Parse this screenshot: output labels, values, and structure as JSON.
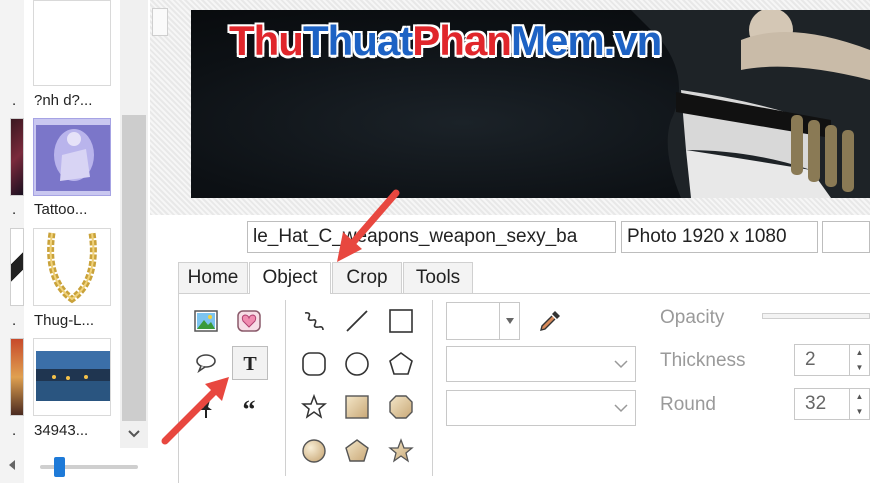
{
  "left_strip": {
    "labels": [
      ".",
      ".",
      ".",
      "."
    ]
  },
  "thumbnails": [
    {
      "label": "?nh d?..."
    },
    {
      "label": "Tattoo..."
    },
    {
      "label": "Thug-L..."
    },
    {
      "label": "34943..."
    }
  ],
  "photo": {
    "watermark": {
      "part1": "Thu",
      "part2": "Thuat",
      "part3": "Phan",
      "part4": "Mem.vn"
    }
  },
  "status_bar": {
    "filename": "le_Hat_C_weapons_weapon_sexy_ba",
    "info": "Photo 1920 x 1080"
  },
  "tabs": [
    {
      "label": "Home"
    },
    {
      "label": "Object",
      "active": true
    },
    {
      "label": "Crop"
    },
    {
      "label": "Tools"
    }
  ],
  "object_tools": {
    "left_icons": [
      "image-icon",
      "sticker-icon",
      "speech-bubble-icon",
      "text-icon",
      "pin-icon",
      "quote-icon"
    ],
    "shape_icons": [
      "freehand-icon",
      "line-icon",
      "rectangle-icon",
      "rounded-rect-icon",
      "circle-icon",
      "pentagon-icon",
      "star-outline-icon",
      "square-filled-icon",
      "rounded-square-icon",
      "circle-filled-icon",
      "pentagon-filled-icon",
      "star-filled-icon"
    ]
  },
  "properties": {
    "opacity_label": "Opacity",
    "thickness_label": "Thickness",
    "thickness_value": "2",
    "round_label": "Round",
    "round_value": "32"
  },
  "colors": {
    "accent": "#1e7ad8",
    "arrow": "#e8473f",
    "selection": "#c9c7f0"
  }
}
